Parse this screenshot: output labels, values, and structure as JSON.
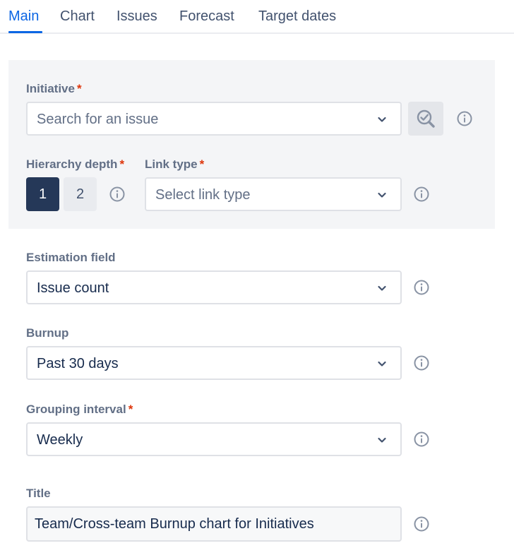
{
  "tabs": [
    {
      "label": "Main",
      "active": true
    },
    {
      "label": "Chart",
      "active": false
    },
    {
      "label": "Issues",
      "active": false
    },
    {
      "label": "Forecast",
      "active": false
    },
    {
      "label": "Target dates",
      "active": false
    }
  ],
  "initiative": {
    "label": "Initiative",
    "required_mark": "*",
    "placeholder": "Search for an issue",
    "action_icon": "check-search-icon"
  },
  "hierarchy_depth": {
    "label": "Hierarchy depth",
    "required_mark": "*",
    "options": [
      "1",
      "2"
    ],
    "selected": "1"
  },
  "link_type": {
    "label": "Link type",
    "required_mark": "*",
    "placeholder": "Select link type"
  },
  "estimation_field": {
    "label": "Estimation field",
    "value": "Issue count"
  },
  "burnup": {
    "label": "Burnup",
    "value": "Past 30 days"
  },
  "grouping_interval": {
    "label": "Grouping interval",
    "required_mark": "*",
    "value": "Weekly"
  },
  "title_field": {
    "label": "Title",
    "value": "Team/Cross-team Burnup chart for Initiatives"
  },
  "colors": {
    "accent": "#0c66e4",
    "required": "#de350b",
    "selected_segment": "#253858",
    "panel_bg": "#f4f5f7"
  },
  "icons": {
    "info": "info-icon",
    "dropdown": "chevron-down-icon"
  }
}
